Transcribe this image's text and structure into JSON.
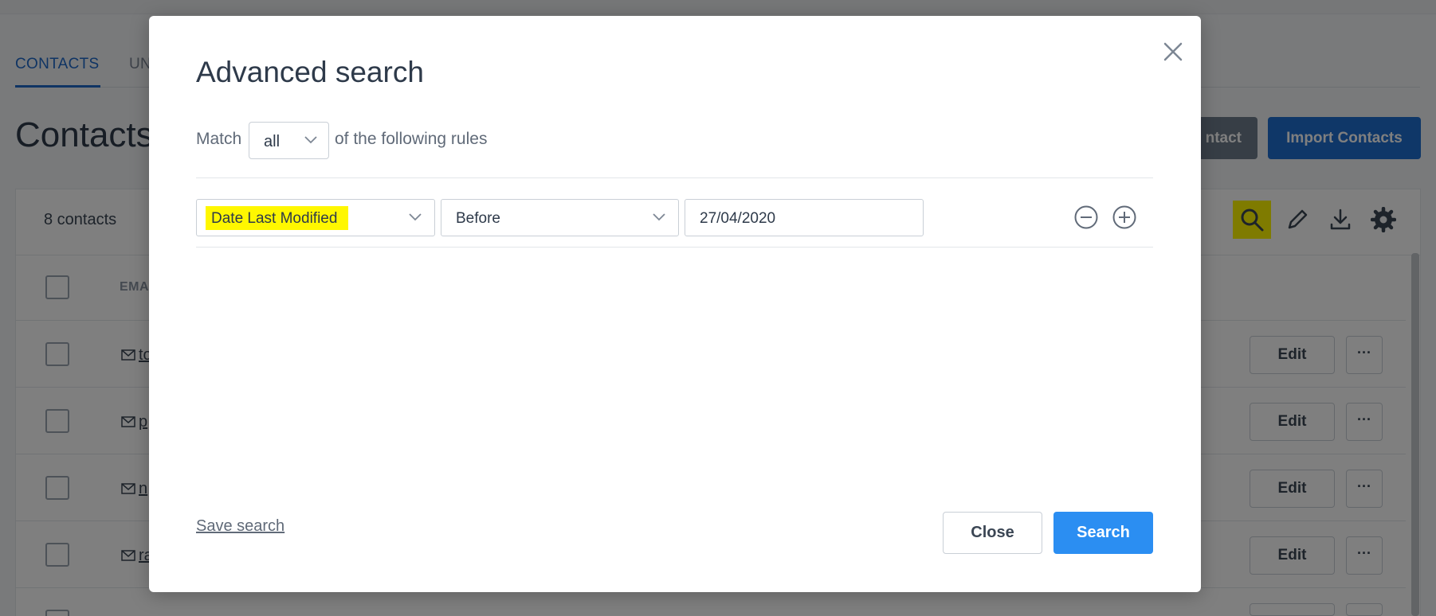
{
  "background": {
    "tabs": [
      {
        "label": "CONTACTS",
        "active": true
      },
      {
        "label": "UN",
        "active": false
      }
    ],
    "page_title": "Contacts",
    "add_contact_label": "ntact",
    "import_label": "Import Contacts",
    "contact_count": "8 contacts",
    "email_column": "EMA",
    "rows": [
      {
        "email": "to",
        "edit": "Edit",
        "more": "···"
      },
      {
        "email": "p",
        "edit": "Edit",
        "more": "···"
      },
      {
        "email": "n",
        "edit": "Edit",
        "more": "···"
      },
      {
        "email": "ra",
        "edit": "Edit",
        "more": "···"
      }
    ],
    "tools": [
      "search-icon",
      "pencil-icon",
      "download-icon",
      "gear-icon"
    ],
    "highlight_color": "#fff700"
  },
  "modal": {
    "title": "Advanced search",
    "match_prefix": "Match",
    "match_value": "all",
    "match_suffix": "of the following rules",
    "rule": {
      "field": "Date Last Modified",
      "operator": "Before",
      "value": "27/04/2020"
    },
    "save_search": "Save search",
    "close_label": "Close",
    "search_label": "Search",
    "accent": "#2b8ef2"
  }
}
